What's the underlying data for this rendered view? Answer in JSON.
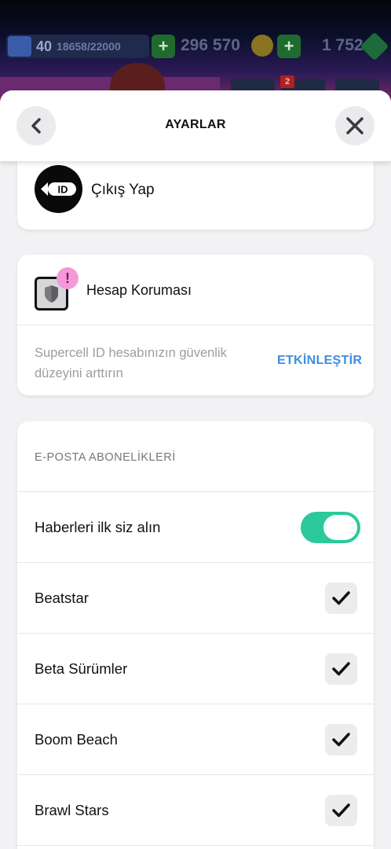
{
  "game_bar": {
    "level": "40",
    "xp": "18658/22000",
    "coins": "296 570",
    "gems": "1 752",
    "notification_count": "2",
    "plus_symbol": "+"
  },
  "header": {
    "title": "AYARLAR",
    "back_icon": "chevron-left-icon",
    "close_icon": "close-icon"
  },
  "logout": {
    "label": "Çıkış Yap",
    "icon_text": "ID"
  },
  "protection": {
    "title": "Hesap Koruması",
    "alert": "!",
    "description": "Supercell ID hesabınızın güvenlik düzeyini arttırın",
    "action": "ETKİNLEŞTİR"
  },
  "email": {
    "section_title": "E-POSTA ABONELİKLERİ",
    "news": {
      "label": "Haberleri ilk siz alın",
      "enabled": true
    },
    "items": [
      {
        "label": "Beatstar",
        "checked": true
      },
      {
        "label": "Beta Sürümler",
        "checked": true
      },
      {
        "label": "Boom Beach",
        "checked": true
      },
      {
        "label": "Brawl Stars",
        "checked": true
      }
    ]
  },
  "colors": {
    "accent_link": "#3d8ee0",
    "toggle_on": "#2cc99a",
    "alert_pink": "#f29ad8"
  }
}
